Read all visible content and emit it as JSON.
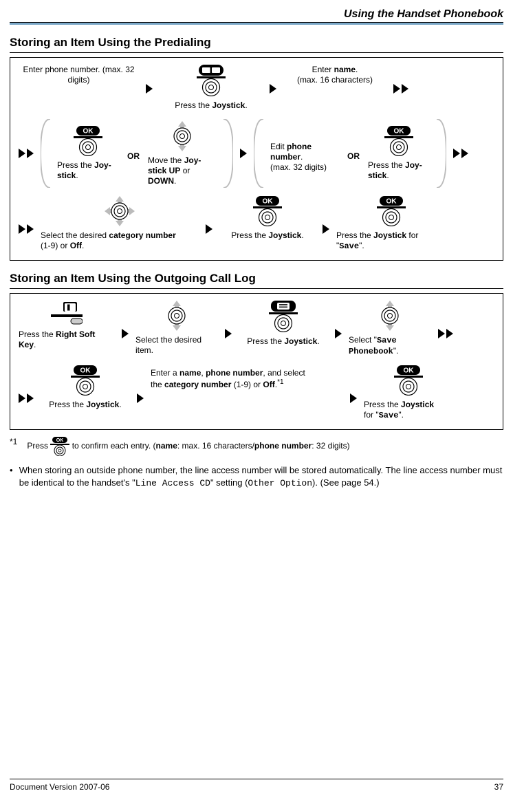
{
  "page_header": "Using the Handset Phonebook",
  "section1_heading": "Storing an Item Using the Predialing",
  "section2_heading": "Storing an Item Using the Outgoing Call Log",
  "or_label": "OR",
  "footer_left": "Document Version 2007-06",
  "footer_page": "37",
  "s1": {
    "step1_line1": "Enter phone number.",
    "step1_line2": "(max. 32 digits)",
    "step2_caption": "Press the Joystick.",
    "step3_line1": "Enter name.",
    "step3_line2": "(max. 16 characters)",
    "step4a_line1": "Press the Joy-",
    "step4a_line2": "stick.",
    "step4b_line1": "Move the Joy-",
    "step4b_line2": "stick UP or",
    "step4b_line3": "DOWN.",
    "step5_line1": "Edit phone",
    "step5_line2": "number.",
    "step5_line3": "(max. 32 digits)",
    "step6_line1": "Press the Joy-",
    "step6_line2": "stick.",
    "step7_line1": "Select the desired category number",
    "step7_line2": "(1-9) or Off.",
    "step8_caption": "Press the Joystick.",
    "step9_line1": "Press the Joystick for",
    "step9_line2_prefix": "\"",
    "step9_line2_mono": "Save",
    "step9_line2_suffix": "\"."
  },
  "s2": {
    "step1_line1": "Press the Right Soft",
    "step1_line2": "Key.",
    "step2_line1": "Select the desired",
    "step2_line2": "item.",
    "step3_caption": "Press the Joystick.",
    "step4_line1_prefix": "Select \"",
    "step4_line1_mono": "Save",
    "step4_line2_mono": "Phonebook",
    "step4_line2_suffix": "\".",
    "step5_caption": "Press the Joystick.",
    "step6_line1": "Enter a name, phone number, and select",
    "step6_line2": "the category number (1-9) or Off.",
    "step7_line1": "Press the Joystick",
    "step7_line2_prefix": "for \"",
    "step7_line2_mono": "Save",
    "step7_line2_suffix": "\"."
  },
  "footnote": {
    "label": "*1",
    "text_prefix": "Press ",
    "text_suffix": " to confirm each entry. (name: max. 16 characters/phone number: 32 digits)"
  },
  "para_prefix": "When storing an outside phone number, the line access number will be stored automatically. The line access number must be identical to the handset's \"",
  "para_mono1": "Line Access CD",
  "para_mid": "\" setting (",
  "para_mono2": "Other Option",
  "para_suffix": "). (See page 54.)"
}
